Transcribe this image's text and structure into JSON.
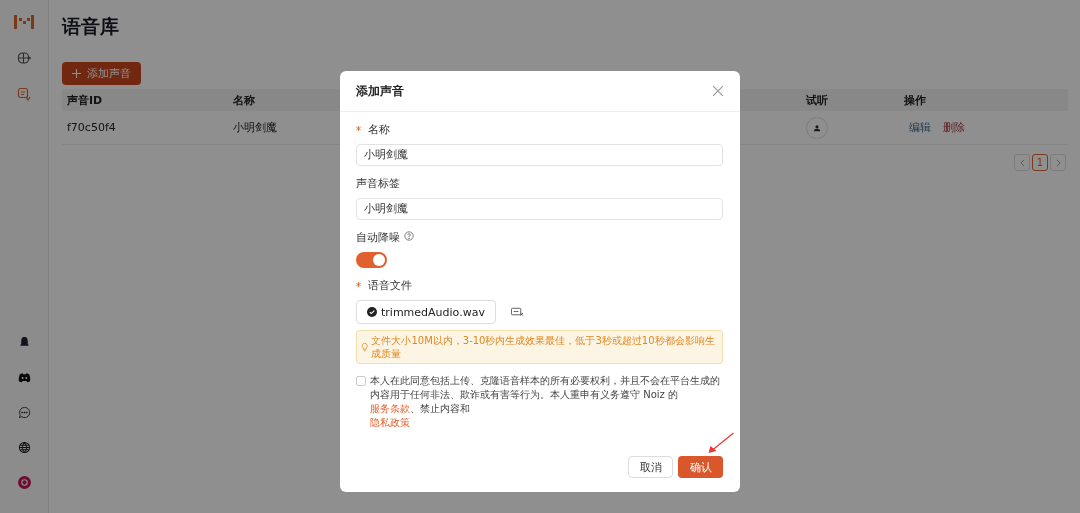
{
  "page": {
    "title": "语音库",
    "add_button": "添加声音"
  },
  "sidebar": {
    "items": [
      {
        "kind": "voice",
        "selected": false
      },
      {
        "kind": "library",
        "selected": true
      }
    ]
  },
  "table": {
    "columns": [
      "声音ID",
      "名称",
      "试听",
      "操作"
    ],
    "rows": [
      {
        "id": "f70c50f4",
        "name": "小明剑魔",
        "edit": "编辑",
        "delete": "删除"
      }
    ]
  },
  "pagination": {
    "pages": [
      {
        "label": "1",
        "selected": true
      }
    ]
  },
  "dialog": {
    "title": "添加声音",
    "fields": [
      {
        "label": "名称",
        "required": true,
        "value": "小明剑魔"
      },
      {
        "label": "声音标签",
        "required": false,
        "value": "小明剑魔"
      }
    ],
    "denoise": {
      "label": "自动降噪",
      "on": true
    },
    "file": {
      "label": "语音文件",
      "required": true,
      "name": "trimmedAudio.wav"
    },
    "tip": "文件大小10M以内，3-10秒内生成效果最佳，低于3秒或超过10秒都会影响生成质量",
    "agreement": {
      "checked": false,
      "text": "本人在此同意包括上传、克隆语音样本的所有必要权利，并且不会在平台生成的内容用于任何非法、欺诈或有害等行为。本人重申有义务遵守 Noiz 的 ",
      "link1": "服务条款",
      "middle": "、禁止内容和",
      "link2": "隐私政策"
    },
    "buttons": {
      "cancel": "取消",
      "confirm": "确认"
    }
  }
}
